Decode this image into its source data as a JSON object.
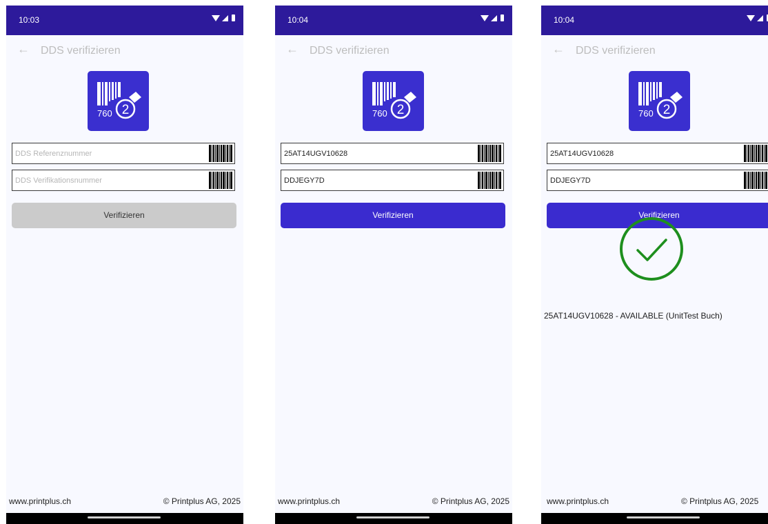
{
  "app": {
    "title": "DDS verifizieren",
    "back_icon": "arrow-left-icon",
    "logo_icon": "barcode-verify-logo-icon",
    "logo_text": "760",
    "logo_badge": "2",
    "footer_url": "www.printplus.ch",
    "footer_copyright": "© Printplus AG, 2025",
    "brand_color": "#2d1a9b",
    "button_color": "#3a2bcf",
    "success_color": "#1e8f1e"
  },
  "screens": [
    {
      "time": "10:03",
      "ref_value": "",
      "ref_placeholder": "DDS Referenznummer",
      "ver_value": "",
      "ver_placeholder": "DDS Verifikationsnummer",
      "button_label": "Verifizieren",
      "button_state": "disabled"
    },
    {
      "time": "10:04",
      "ref_value": "25AT14UGV10628",
      "ref_placeholder": "DDS Referenznummer",
      "ver_value": "DDJEGY7D",
      "ver_placeholder": "DDS Verifikationsnummer",
      "button_label": "Verifizieren",
      "button_state": "enabled"
    },
    {
      "time": "10:04",
      "ref_value": "25AT14UGV10628",
      "ref_placeholder": "DDS Referenznummer",
      "ver_value": "DDJEGY7D",
      "ver_placeholder": "DDS Verifikationsnummer",
      "button_label": "Verifizieren",
      "button_state": "enabled",
      "result_icon": "check-circle-icon",
      "result_text": "25AT14UGV10628 - AVAILABLE (UnitTest Buch)"
    }
  ]
}
